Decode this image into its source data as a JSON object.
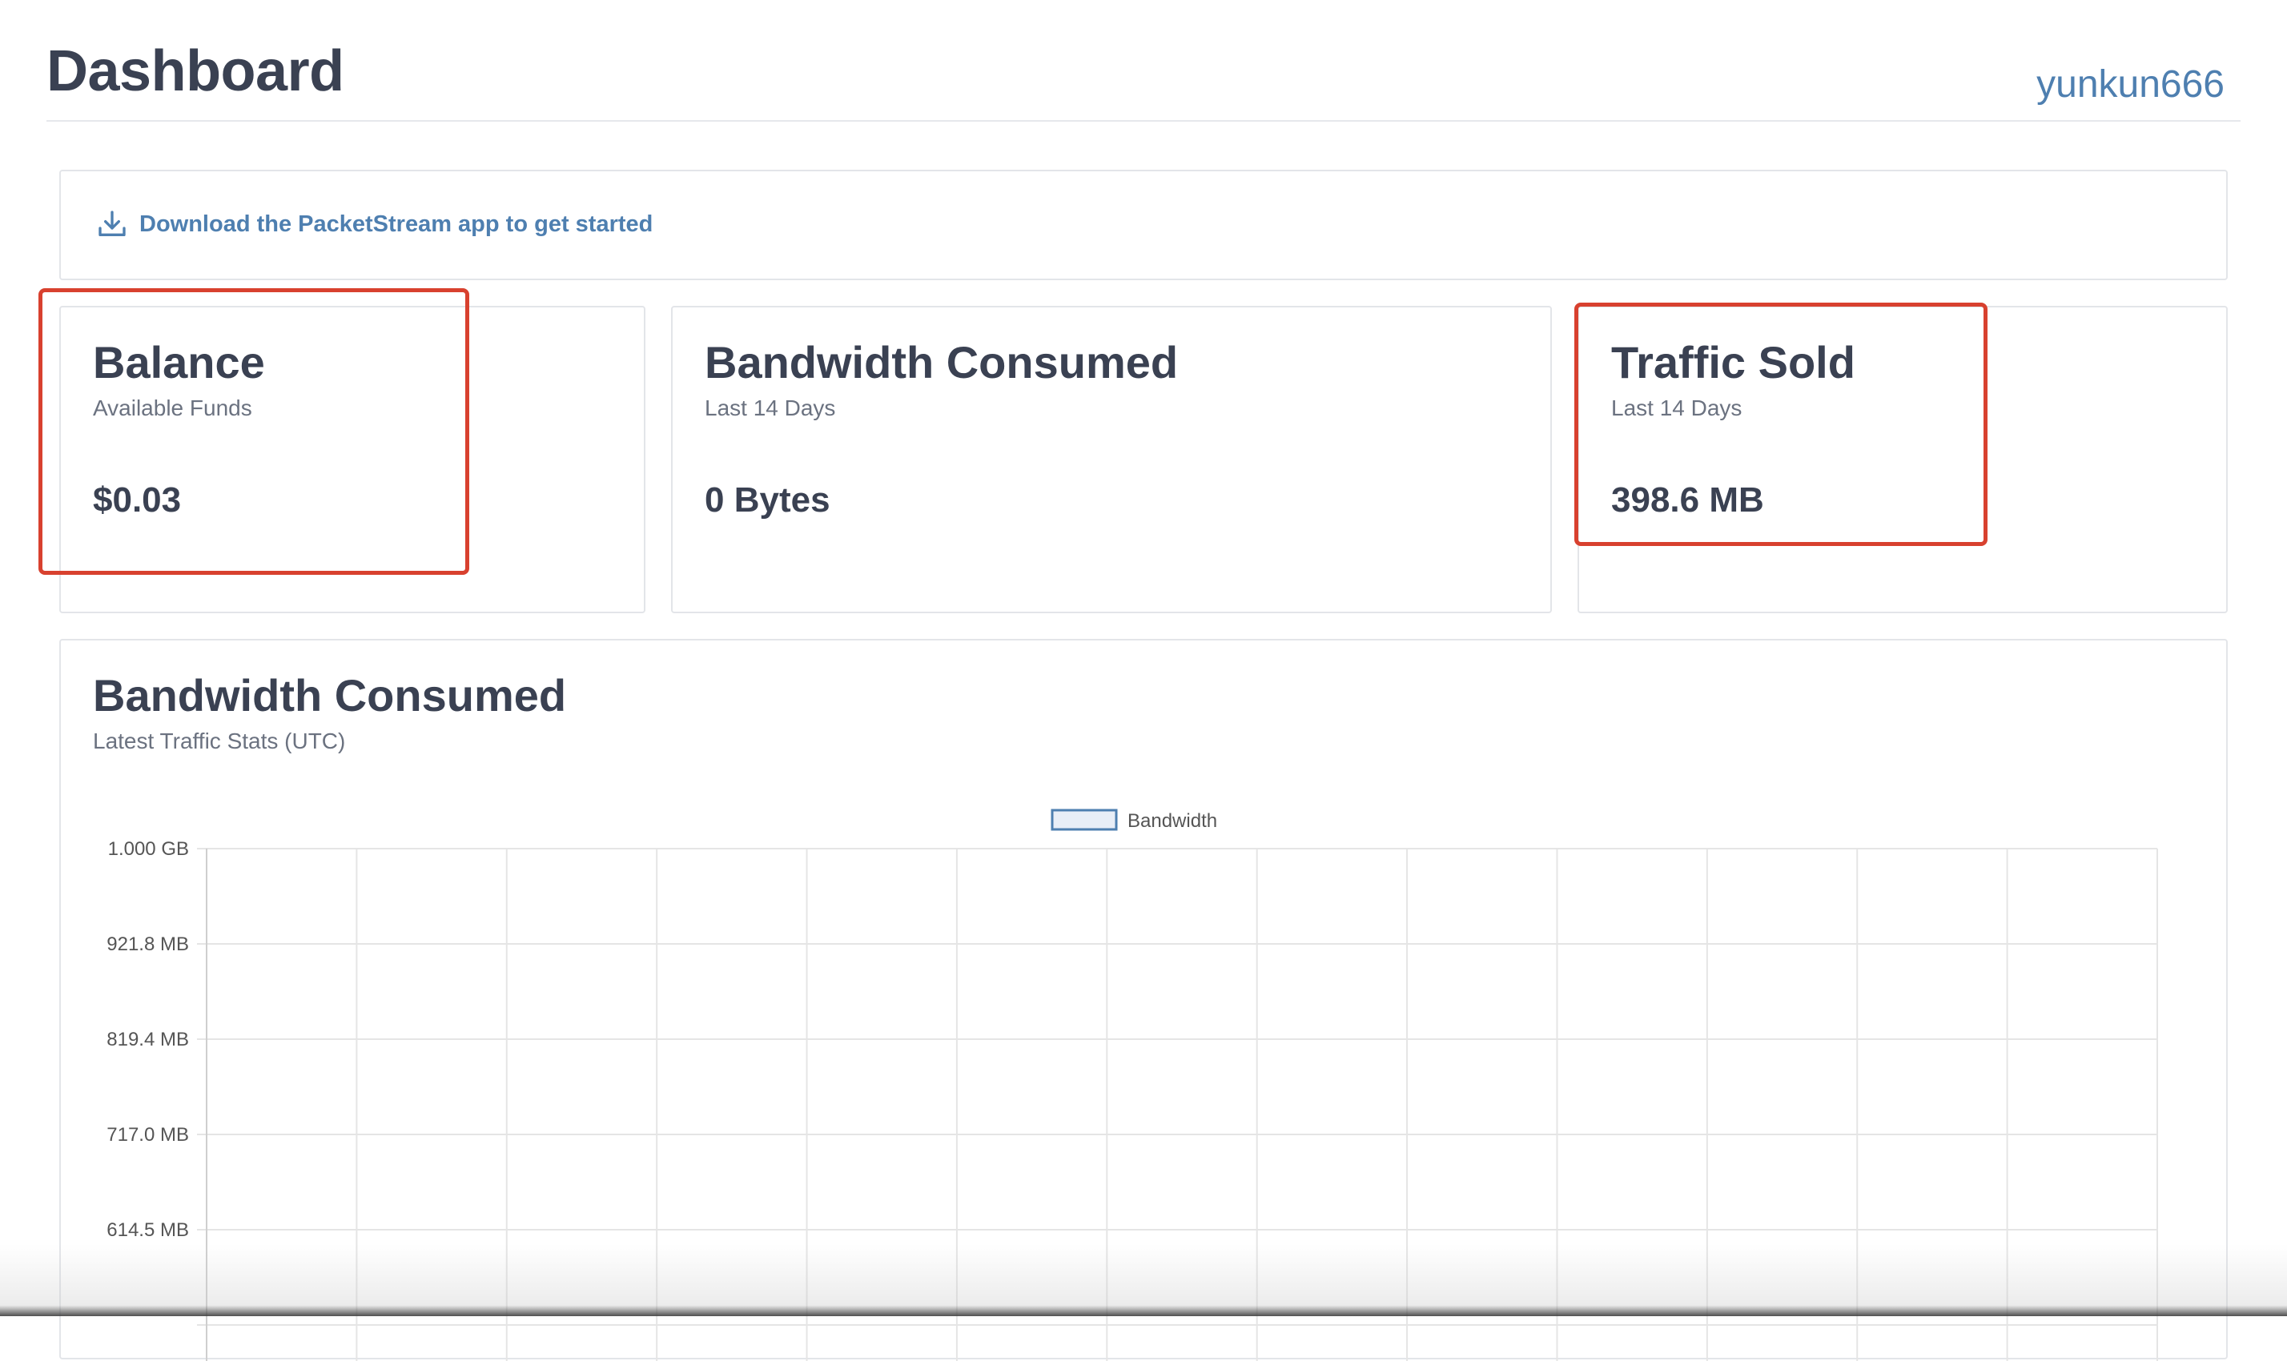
{
  "header": {
    "title": "Dashboard",
    "username": "yunkun666"
  },
  "download_banner": {
    "icon": "download-icon",
    "label": "Download the PacketStream app to get started"
  },
  "stats": {
    "balance": {
      "title": "Balance",
      "subtitle": "Available Funds",
      "value": "$0.03"
    },
    "bandwidth": {
      "title": "Bandwidth Consumed",
      "subtitle": "Last 14 Days",
      "value": "0 Bytes"
    },
    "traffic": {
      "title": "Traffic Sold",
      "subtitle": "Last 14 Days",
      "value": "398.6 MB"
    }
  },
  "chart_section": {
    "title": "Bandwidth Consumed",
    "subtitle": "Latest Traffic Stats (UTC)"
  },
  "colors": {
    "accent": "#4e7fb0",
    "highlight": "#d8412f",
    "legend_fill": "#e8eef7",
    "legend_stroke": "#4e7fb0",
    "grid": "#e5e5e5"
  },
  "chart_data": {
    "type": "line",
    "title": "",
    "xlabel": "",
    "ylabel": "",
    "legend": "top-center",
    "series": [
      {
        "name": "Bandwidth",
        "values": []
      }
    ],
    "y_ticks": [
      "1.000 GB",
      "921.8 MB",
      "819.4 MB",
      "717.0 MB",
      "614.5 MB"
    ],
    "x_gridlines": 14,
    "grid": true
  }
}
